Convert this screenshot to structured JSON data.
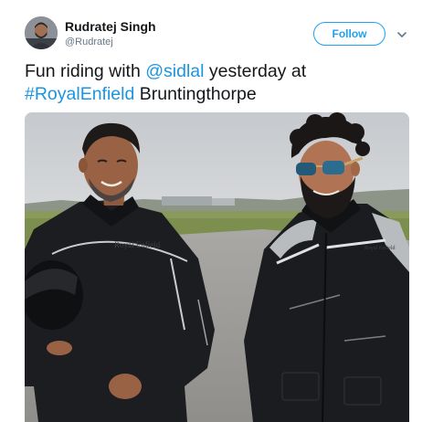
{
  "tweet": {
    "author": {
      "name": "Rudratej Singh",
      "handle": "@Rudratej",
      "avatar_icon": "avatar-photo-icon"
    },
    "follow_label": "Follow",
    "menu_icon": "chevron-down-icon",
    "text": {
      "line1_prefix": "Fun riding with ",
      "mention": "@sidlal",
      "line1_suffix": " yesterday at",
      "hashtag": "#RoyalEnfield",
      "line2_suffix": " Bruntingthorpe"
    },
    "media": {
      "kind": "photo",
      "jacket_text": "Royal Enfield",
      "jacket_text_right": "Royal Enfield"
    }
  },
  "colors": {
    "accent": "#1da1f2",
    "link": "#1b95e0",
    "text": "#14171a",
    "secondary_text": "#657786"
  }
}
